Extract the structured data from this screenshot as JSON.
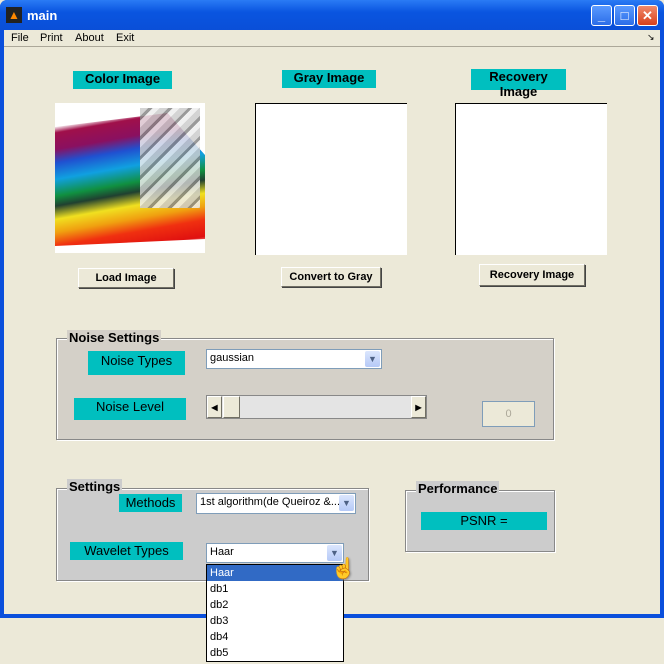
{
  "window": {
    "title": "main",
    "app_icon": "matlab-icon",
    "controls": [
      "minimize",
      "maximize",
      "close"
    ]
  },
  "menu": [
    "File",
    "Print",
    "About",
    "Exit"
  ],
  "images": {
    "color_label": "Color Image",
    "gray_label": "Gray Image",
    "recovery_label": "Recovery Image"
  },
  "buttons": {
    "load": "Load Image",
    "convert": "Convert to Gray",
    "recovery": "Recovery Image"
  },
  "noise": {
    "title": "Noise Settings",
    "types_label": "Noise Types",
    "types_value": "gaussian",
    "level_label": "Noise Level",
    "level_value": "0",
    "slider_value": 0
  },
  "settings": {
    "title": "Settings",
    "methods_label": "Methods",
    "methods_value": "1st algorithm(de Queiroz &...",
    "wavelet_label": "Wavelet Types",
    "wavelet_value": "Haar",
    "wavelet_options": [
      "Haar",
      "db1",
      "db2",
      "db3",
      "db4",
      "db5"
    ],
    "selected_option": "Haar"
  },
  "performance": {
    "title": "Performance",
    "psnr_label": "PSNR ="
  },
  "colors": {
    "accent": "#00bfbf",
    "selection": "#316ac5",
    "titlebar": "#0a4fdc"
  }
}
